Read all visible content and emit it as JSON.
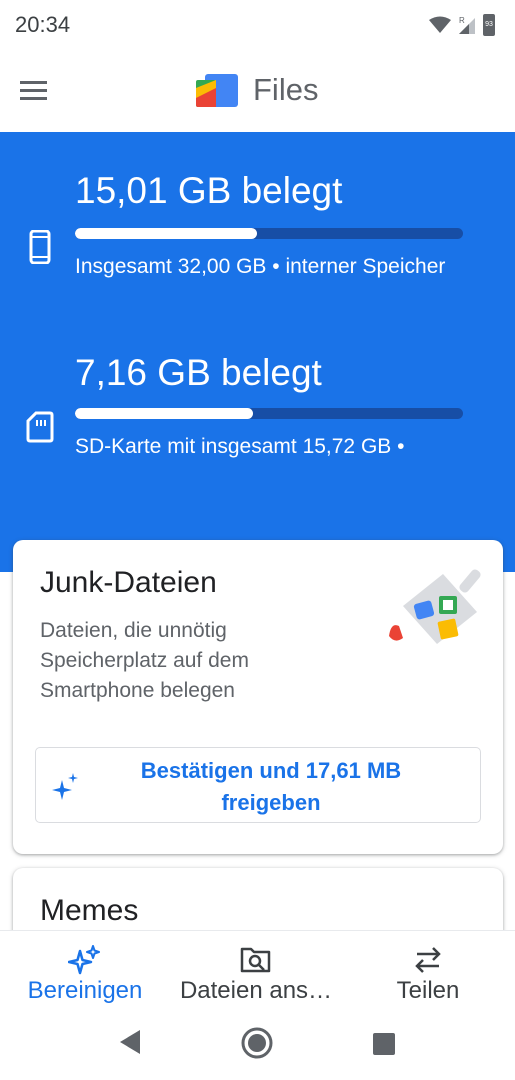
{
  "status_bar": {
    "time": "20:34",
    "roaming_label": "R",
    "battery_level": "93"
  },
  "app_bar": {
    "title": "Files"
  },
  "storage": {
    "internal": {
      "used_label": "15,01 GB belegt",
      "subtitle": "Insgesamt 32,00 GB • interner Speicher",
      "used_fraction": 0.47
    },
    "sd_card": {
      "used_label": "7,16 GB belegt",
      "subtitle": "SD-Karte mit insgesamt 15,72 GB •",
      "used_fraction": 0.46
    }
  },
  "junk_card": {
    "title": "Junk-Dateien",
    "description": "Dateien, die unnötig Speicherplatz auf dem Smartphone belegen",
    "action_label": "Bestätigen und 17,61 MB freigeben"
  },
  "memes_card": {
    "title": "Memes"
  },
  "bottom_nav": {
    "items": [
      {
        "label": "Bereinigen",
        "icon": "sparkle-icon",
        "active": true
      },
      {
        "label": "Dateien ans…",
        "icon": "folder-search-icon",
        "active": false
      },
      {
        "label": "Teilen",
        "icon": "swap-arrows-icon",
        "active": false
      }
    ]
  },
  "system_nav": {
    "back": "back-icon",
    "home": "home-icon",
    "recents": "recents-icon"
  },
  "colors": {
    "accent": "#1a73e8",
    "accent_dark": "#174ea6",
    "text_secondary": "#5f6368"
  }
}
